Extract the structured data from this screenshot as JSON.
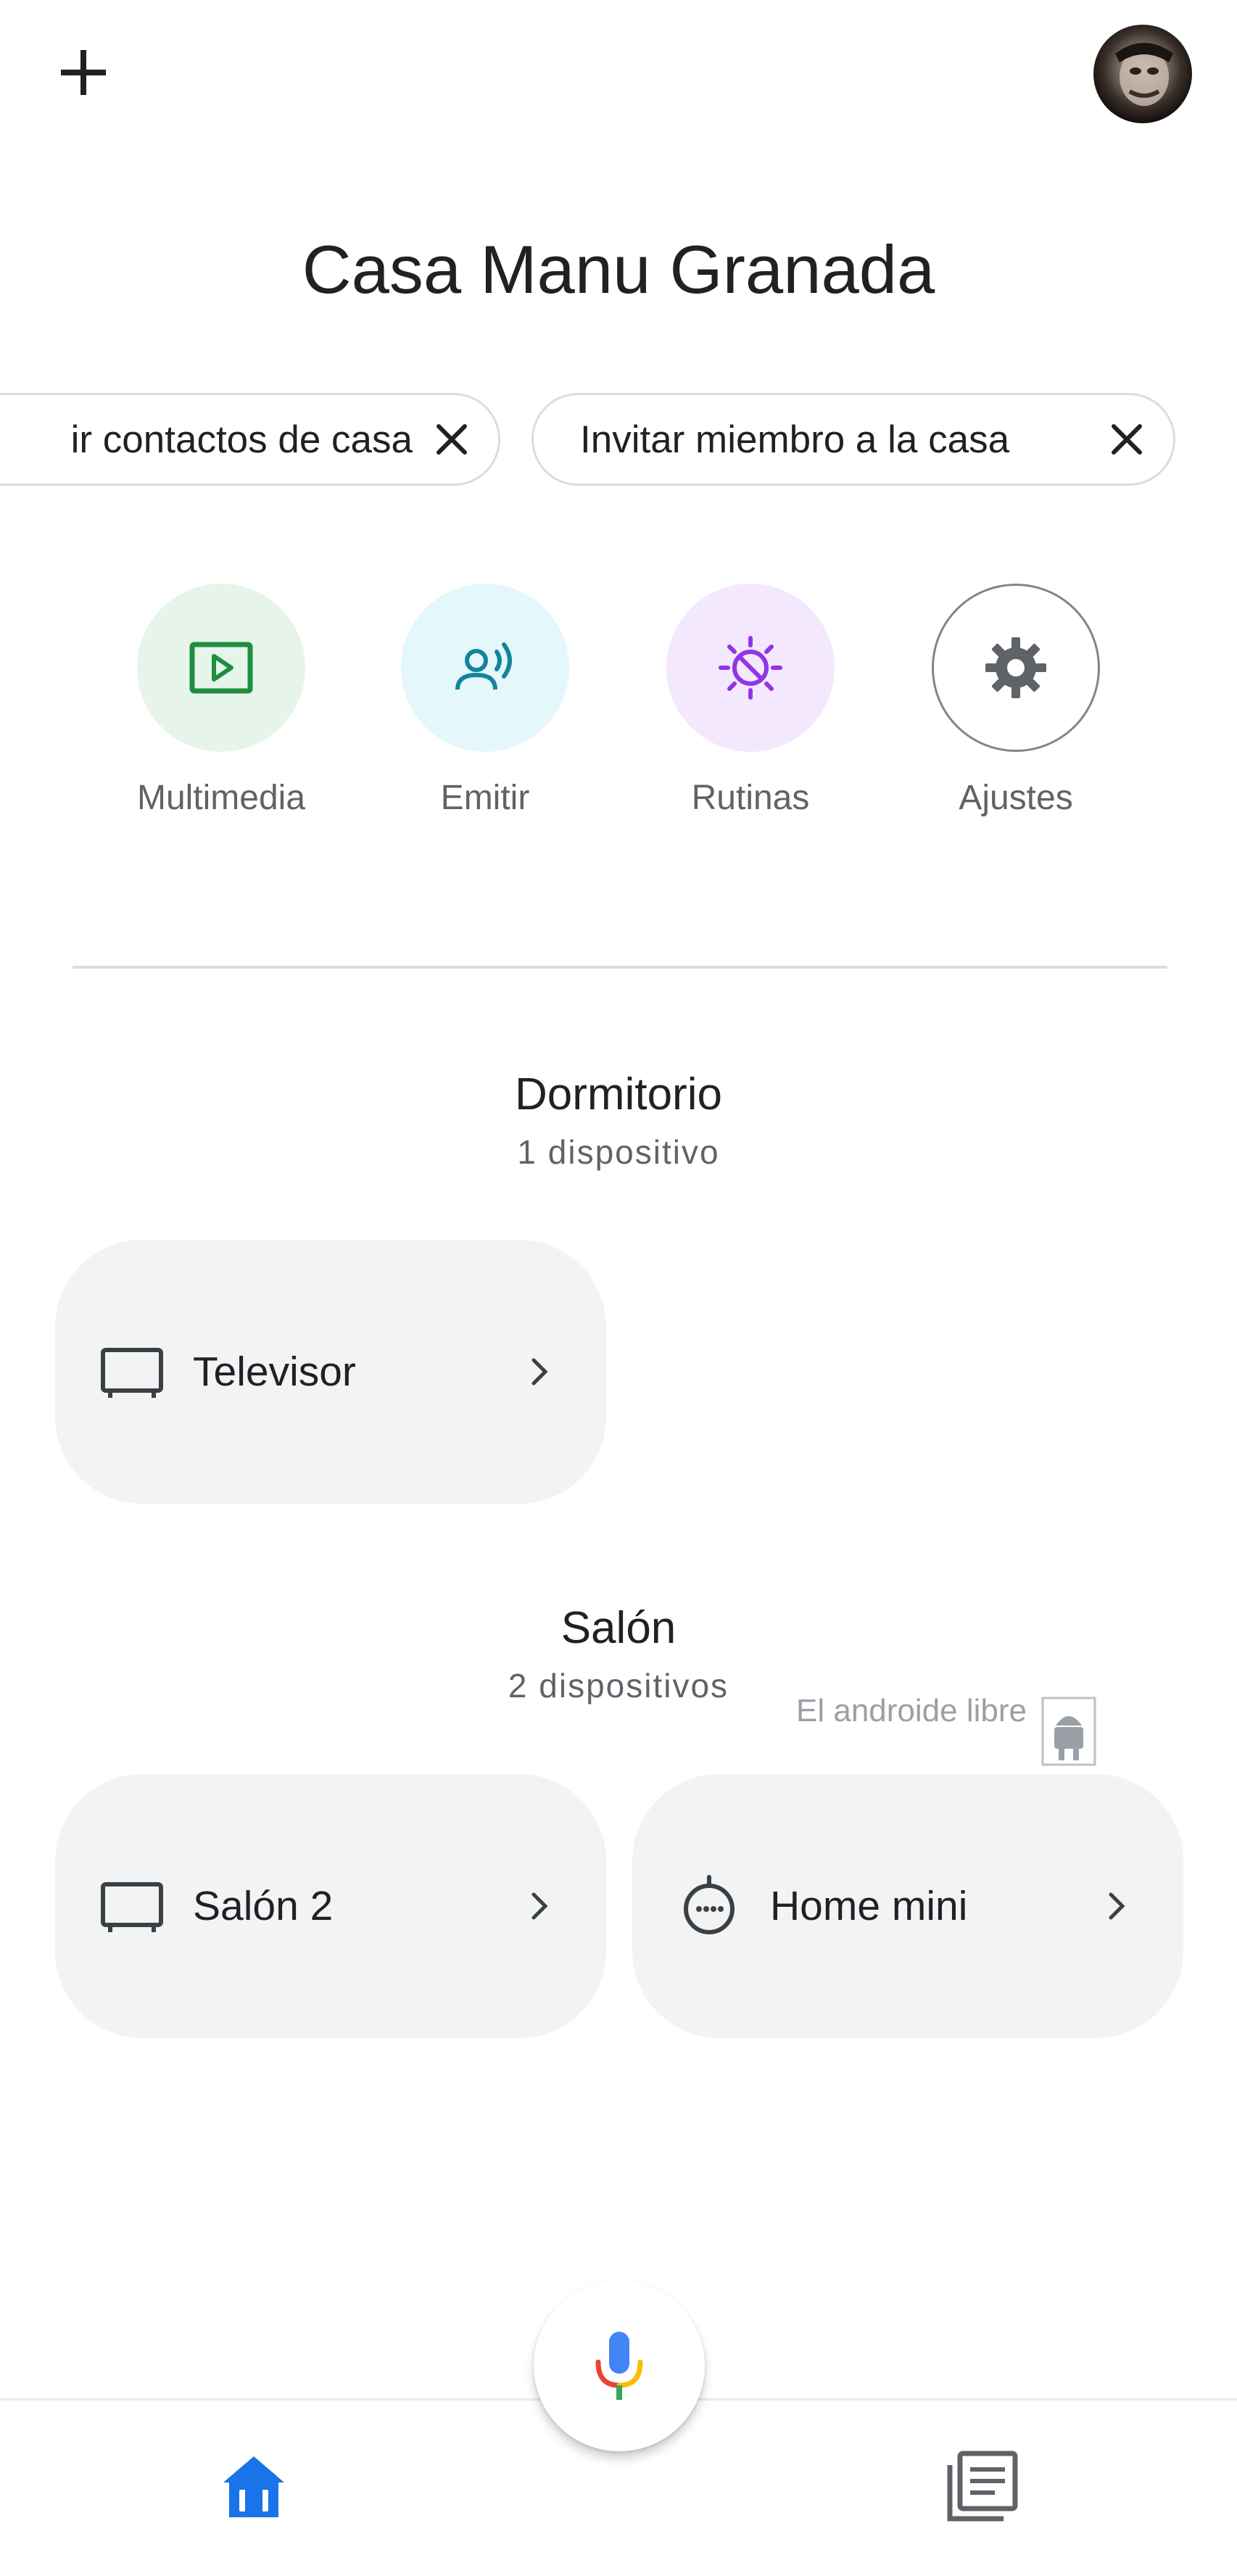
{
  "header": {
    "home_name": "Casa Manu Granada",
    "add_icon": "plus-icon",
    "avatar": "profile-photo"
  },
  "chips": [
    {
      "label": "ir contactos de casa",
      "icon": "close-icon"
    },
    {
      "label": "Invitar miembro a la casa",
      "icon": "close-icon"
    }
  ],
  "actions": [
    {
      "label": "Multimedia",
      "icon": "play-box-icon",
      "color": "#1e8e3e",
      "bg": "#e6f4ea"
    },
    {
      "label": "Emitir",
      "icon": "cast-voice-icon",
      "color": "#12859b",
      "bg": "#e4f7fb"
    },
    {
      "label": "Rutinas",
      "icon": "routine-sun-icon",
      "color": "#9334e6",
      "bg": "#f3e8fd"
    },
    {
      "label": "Ajustes",
      "icon": "gear-icon",
      "color": "#5f6368",
      "bg": "#ffffff"
    }
  ],
  "rooms": [
    {
      "name": "Dormitorio",
      "count": "1 dispositivo",
      "devices": [
        {
          "label": "Televisor",
          "icon": "tv-icon"
        }
      ]
    },
    {
      "name": "Salón",
      "count": "2 dispositivos",
      "devices": [
        {
          "label": "Salón 2",
          "icon": "tv-icon"
        },
        {
          "label": "Home mini",
          "icon": "speaker-icon"
        }
      ]
    }
  ],
  "watermark": "El androide libre",
  "bottom_nav": {
    "home_icon": "home-icon",
    "feed_icon": "feed-icon",
    "mic_icon": "mic-icon",
    "active_color": "#1a73e8"
  }
}
